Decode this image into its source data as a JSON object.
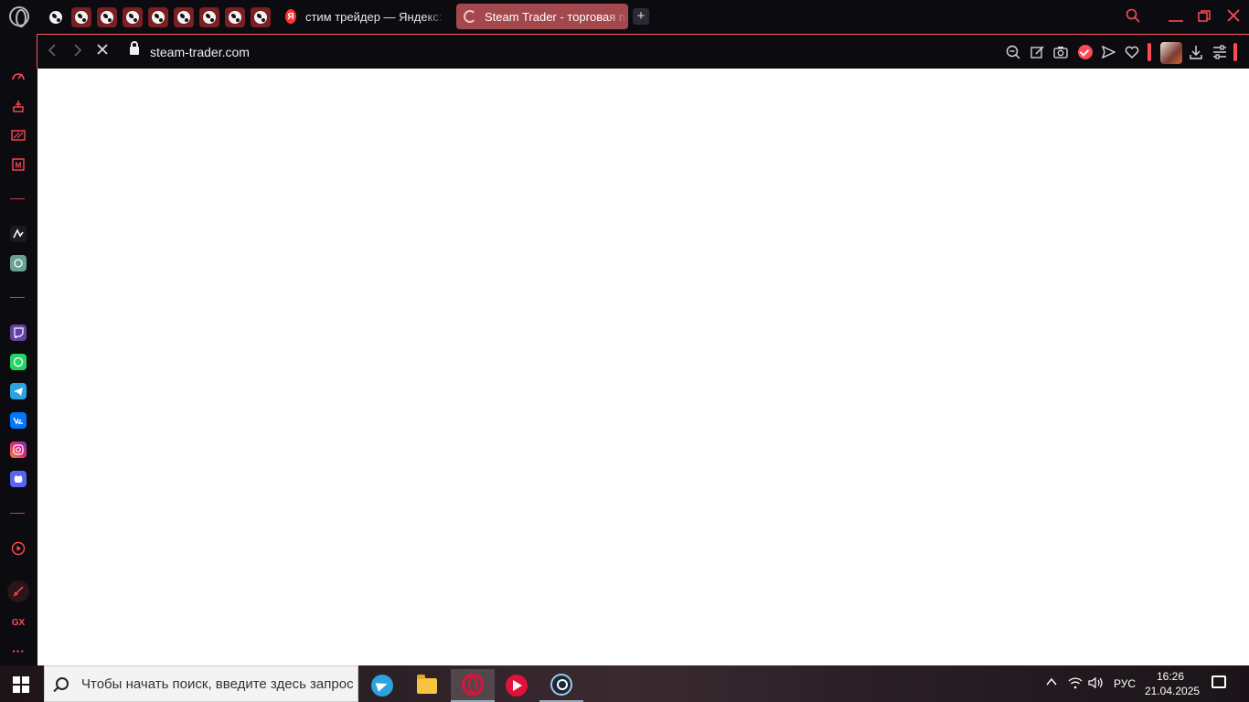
{
  "browser": {
    "pinned_tab_count": 9,
    "tabs": [
      {
        "title": "стим трейдер — Яндекс: нашлось",
        "favicon": "yandex-icon",
        "active": false
      },
      {
        "title": "Steam Trader - торговая площадка",
        "favicon": "loading-spinner-icon",
        "active": true
      }
    ],
    "new_tab_label": "+",
    "url": "steam-trader.com"
  },
  "sidebar": {
    "items": [
      "speed-dial-icon",
      "easy-setup-icon",
      "gx-control-icon",
      "gx-corner-icon",
      "aria-icon",
      "chatgpt-icon",
      "twitch-icon",
      "whatsapp-icon",
      "telegram-icon",
      "vk-icon",
      "instagram-icon",
      "discord-icon",
      "player-icon",
      "no-draw-icon",
      "gx-label",
      "more-icon"
    ],
    "gx_label": "GX",
    "more_label": "···"
  },
  "taskbar": {
    "search_placeholder": "Чтобы начать поиск, введите здесь запрос",
    "language": "РУС",
    "time": "16:26",
    "date": "21.04.2025"
  },
  "colors": {
    "accent": "#ff4a55",
    "active_tab": "#a3484c",
    "background": "#0b0b10"
  }
}
